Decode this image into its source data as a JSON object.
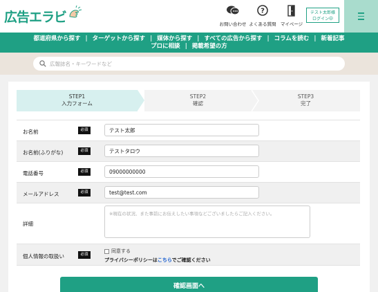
{
  "header": {
    "logo_text": "広告エラビ",
    "nav": [
      {
        "label": "お問い合わせ",
        "icon": "chat-bubbles-icon"
      },
      {
        "label": "よくある質問",
        "icon": "question-circle-icon"
      },
      {
        "label": "マイページ",
        "icon": "door-icon"
      }
    ],
    "login_line1": "テスト太郎様",
    "login_line2": "ログイン中",
    "menu_icon": "hamburger-menu-icon"
  },
  "colors": {
    "brand": "#1fa084",
    "menu_bg": "#a9dccd",
    "step_active": "#d7f0ef",
    "band": "#ebe4dc",
    "link": "#1a5fd0"
  },
  "global_nav": {
    "row1": [
      "都道府県から探す",
      "ターゲットから探す",
      "媒体から探す",
      "すべての広告から探す",
      "コラムを読む",
      "新着記事"
    ],
    "row2": [
      "プロに相談",
      "掲載希望の方"
    ]
  },
  "search": {
    "placeholder": "広報誌名・キーワードなど",
    "icon": "search-icon"
  },
  "steps": [
    {
      "step": "STEP1",
      "label": "入力フォーム",
      "active": true
    },
    {
      "step": "STEP2",
      "label": "確認",
      "active": false
    },
    {
      "step": "STEP3",
      "label": "完了",
      "active": false
    }
  ],
  "form": {
    "required_badge": "必須",
    "fields": [
      {
        "label": "お名前",
        "value": "テスト太郎"
      },
      {
        "label": "お名前(ふりがな)",
        "value": "テストタロウ"
      },
      {
        "label": "電話番号",
        "value": "09000000000"
      },
      {
        "label": "メールアドレス",
        "value": "test@test.com"
      }
    ],
    "detail": {
      "label": "詳細",
      "placeholder": "※現在の状況、また事前にお伝えしたい事項などございましたらご記入ください。"
    },
    "privacy": {
      "label": "個人情報の取扱い",
      "agree_label": "同意する",
      "policy_prefix": "プライバシーポリシーは",
      "policy_link": "こちら",
      "policy_suffix": "でご確認ください"
    },
    "submit_label": "確認画面へ"
  }
}
